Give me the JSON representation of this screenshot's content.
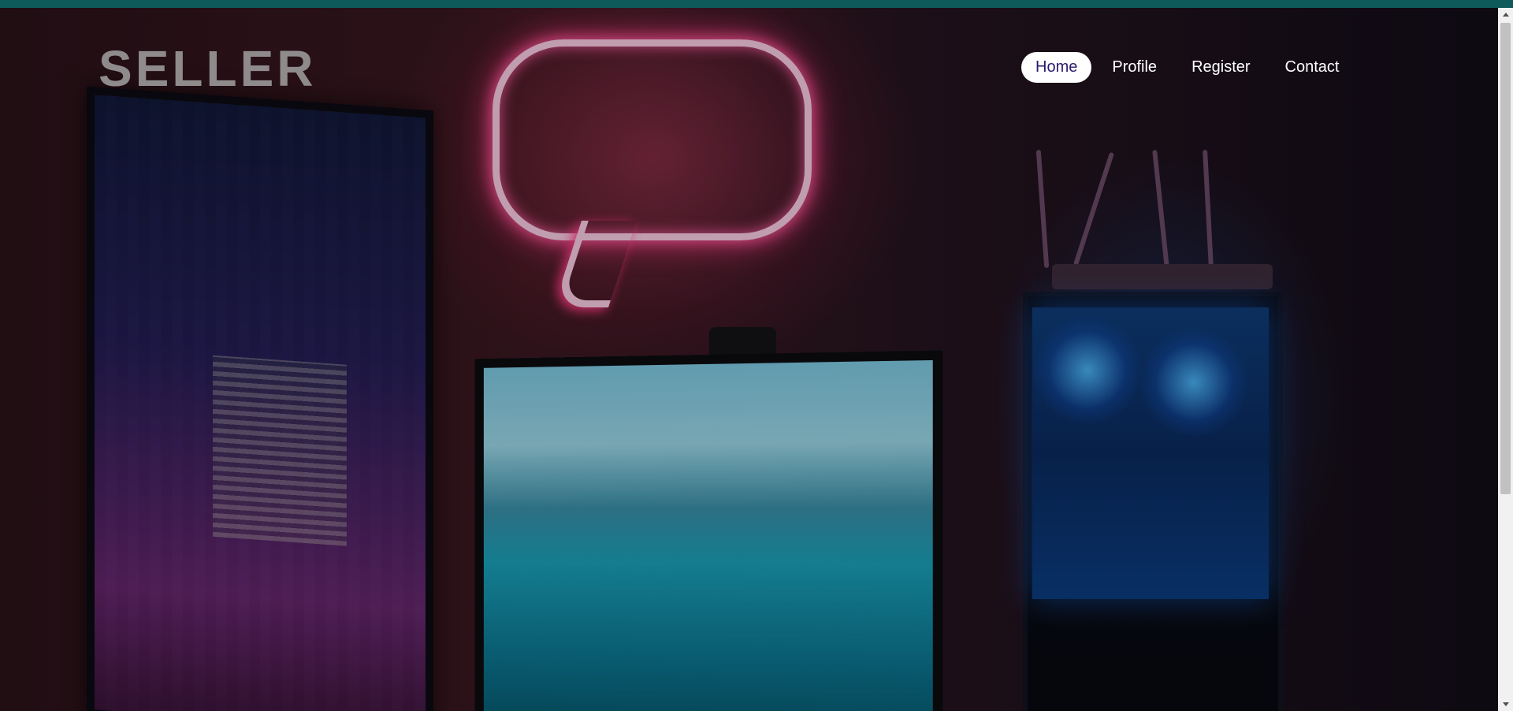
{
  "header": {
    "logo_text": "SELLER"
  },
  "nav": {
    "items": [
      {
        "label": "Home",
        "active": true
      },
      {
        "label": "Profile",
        "active": false
      },
      {
        "label": "Register",
        "active": false
      },
      {
        "label": "Contact",
        "active": false
      }
    ]
  },
  "hero": {
    "background_description_icon": "photo-gaming-setup"
  },
  "scrollbar": {
    "position_fraction": 0.0
  },
  "colors": {
    "topbar": "#0e5a5a",
    "logo": "#8f8b8d",
    "nav_text": "#ffffff",
    "nav_active_bg": "#ffffff",
    "nav_active_text": "#2b1b6f"
  }
}
